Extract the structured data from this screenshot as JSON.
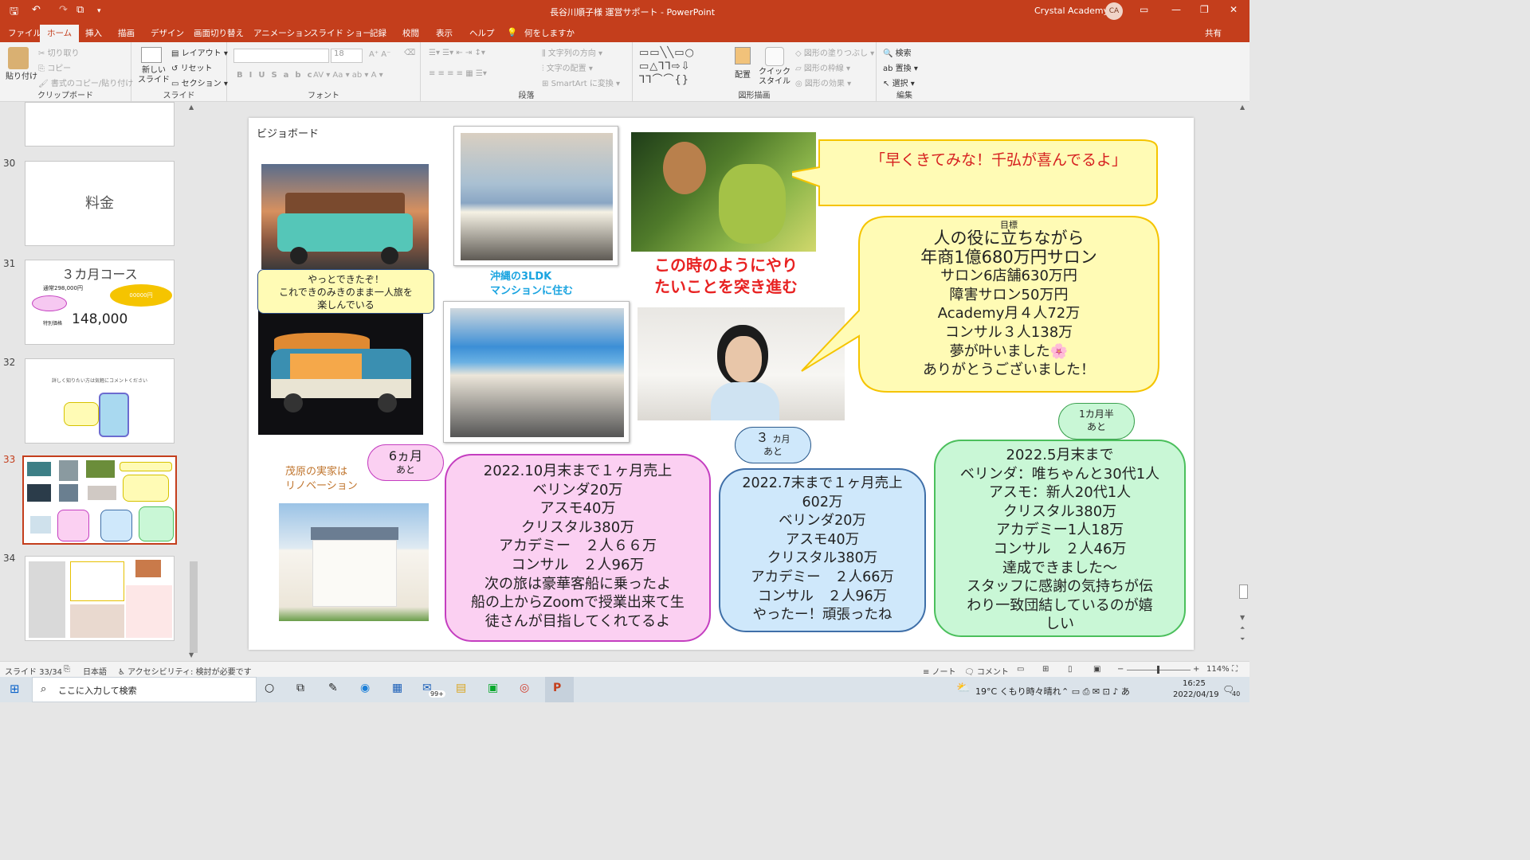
{
  "window": {
    "title": "長谷川順子様 運営サポート - PowerPoint",
    "account": "Crystal Academy",
    "avatar": "CA",
    "share": "共有"
  },
  "menu": [
    "ファイル",
    "ホーム",
    "挿入",
    "描画",
    "デザイン",
    "画面切り替え",
    "アニメーション",
    "スライド ショー",
    "記録",
    "校閲",
    "表示",
    "ヘルプ"
  ],
  "menu_tell": "何をしますか",
  "ribbon": {
    "clipboard": {
      "paste": "貼り付け",
      "cut": "切り取り",
      "copy": "コピー",
      "format_painter": "書式のコピー/貼り付け",
      "label": "クリップボード"
    },
    "slides": {
      "new_slide": "新しい スライド",
      "layout": "レイアウト",
      "reset": "リセット",
      "section": "セクション",
      "label": "スライド"
    },
    "font": {
      "size": "18",
      "label": "フォント"
    },
    "paragraph": {
      "text_direction": "文字列の方向",
      "align_text": "文字の配置",
      "smartart": "SmartArt に変換",
      "label": "段落"
    },
    "drawing": {
      "arrange": "配置",
      "quick_styles": "クイック スタイル",
      "fill": "図形の塗りつぶし",
      "outline": "図形の枠線",
      "effects": "図形の効果",
      "label": "図形描画"
    },
    "editing": {
      "find": "検索",
      "replace": "置換",
      "select": "選択",
      "label": "編集"
    }
  },
  "thumbs": [
    {
      "num": "30",
      "title": "料金"
    },
    {
      "num": "31",
      "title": "３カ月コース",
      "regular": "通常298,000円",
      "special_label": "特別価格",
      "price": "148,000",
      "pill": "00000円"
    },
    {
      "num": "32",
      "text": "詳しく知りたい方は気軽にコメントください"
    },
    {
      "num": "33"
    },
    {
      "num": "34"
    }
  ],
  "slide": {
    "title": "ビジョボード",
    "caption_camper": "やっとできたぞ！\nこれできのみきのまま一人旅を\n楽しんでいる",
    "caption_okinawa": "沖縄の3LDK\nマンションに住む",
    "quote": "「早くきてみな！千弘が喜んでるよ」",
    "red_text": "この時のようにやり\nたいことを突き進む",
    "goal_label": "目標",
    "goal_lines": [
      "人の役に立ちながら",
      "年商1億680万円サロン",
      "サロン6店舗630万円",
      "障害サロン50万円",
      "Academy月４人72万",
      "コンサル３人138万",
      "夢が叶いました🌸",
      "ありがとうございました！"
    ],
    "renovation": "茂原の実家は\nリノベーション",
    "badge_6m": {
      "big": "6ヵ月",
      "small": "あと"
    },
    "badge_3m": {
      "big": "３",
      "unit": "カ月",
      "small": "あと"
    },
    "badge_15m": {
      "top": "1カ月半",
      "bottom": "あと"
    },
    "pink_lines": [
      "2022.10月末まで１ヶ月売上",
      "ベリンダ20万",
      "アスモ40万",
      "クリスタル380万",
      "アカデミー　２人６６万",
      "コンサル　２人96万",
      "次の旅は豪華客船に乗ったよ",
      "船の上からZoomで授業出来て生",
      "徒さんが目指してくれてるよ"
    ],
    "blue_lines": [
      "2022.7末まで１ヶ月売上",
      "602万",
      "ベリンダ20万",
      "アスモ40万",
      "クリスタル380万",
      "アカデミー　２人66万",
      "コンサル　２人96万",
      "やったー！頑張ったね"
    ],
    "green_lines": [
      "2022.5月末まで",
      "ベリンダ：唯ちゃんと30代1人",
      "アスモ：新人20代1人",
      "クリスタル380万",
      "アカデミー1人18万",
      "コンサル　２人46万",
      "達成できました〜",
      "スタッフに感謝の気持ちが伝",
      "わり一致団結しているのが嬉",
      "しい"
    ]
  },
  "status": {
    "slide": "スライド 33/34",
    "lang": "日本語",
    "access": "アクセシビリティ: 検討が必要です",
    "notes": "ノート",
    "comments": "コメント",
    "zoom": "114%"
  },
  "taskbar": {
    "search": "ここに入力して検索",
    "weather": "19°C くもり時々晴れ",
    "time": "16:25",
    "date": "2022/04/19",
    "mail_badge": "99+",
    "notif": "40"
  },
  "colors": {
    "accent": "#c43e1c",
    "pink": "#fbd0f2",
    "blue": "#cfe8fb",
    "green": "#c9f7d6",
    "yellow": "#fffbb5"
  }
}
